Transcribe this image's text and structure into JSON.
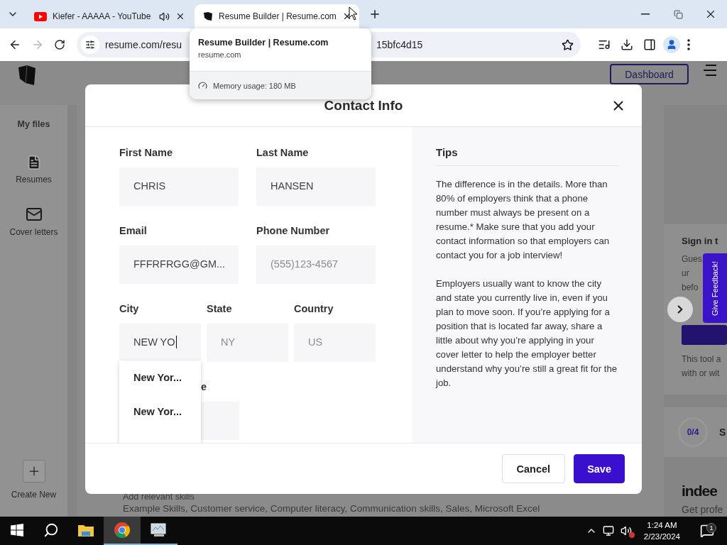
{
  "browser": {
    "tabs": [
      {
        "title": "Kiefer - AAAAA - YouTube",
        "kind": "video",
        "selected": false,
        "audio": true
      },
      {
        "title": "Resume Builder | Resume.com",
        "kind": "site",
        "selected": true,
        "audio": false
      }
    ],
    "forward_disabled": true,
    "address": {
      "url_start": "resume.com/resu",
      "url_end": "15bfc4d15"
    },
    "hover_card": {
      "title": "Resume Builder | Resume.com",
      "domain": "resume.com",
      "memory": "Memory usage: 180 MB"
    }
  },
  "page": {
    "header": {
      "dashboard": "Dashboard"
    },
    "sidebar": {
      "heading": "My files",
      "items": [
        {
          "label": "Resumes",
          "kind": "document"
        },
        {
          "label": "Cover letters",
          "kind": "mail"
        }
      ],
      "create": "Create New"
    },
    "content": {
      "hint": "Add relevant skills",
      "example": "Example Skills, Customer service, Computer literacy, Communication skills, Sales, Microsoft Excel"
    },
    "right_panel": {
      "heading": "Sign in t",
      "lines": [
        "Gues",
        "ur",
        "befo"
      ],
      "note": [
        "This tool a",
        "with or wit"
      ],
      "progress": "0/4",
      "progress_label": "S",
      "brand": "indee",
      "brand_text": "Get profe",
      "feedback": "Give Feedback!"
    }
  },
  "modal": {
    "title": "Contact Info",
    "rows": [
      [
        {
          "label": "First Name",
          "value": "CHRIS",
          "focused": false
        },
        {
          "label": "Last Name",
          "value": "HANSEN",
          "focused": false
        }
      ],
      [
        {
          "label": "Email",
          "value": "FFFRFRGG@GM...",
          "focused": false
        },
        {
          "label": "Phone Number",
          "placeholder": "(555)123-4567",
          "focused": false
        }
      ],
      [
        {
          "label": "City",
          "value": "NEW YO",
          "focused": true
        },
        {
          "label": "State",
          "placeholder": "NY",
          "focused": false
        },
        {
          "label": "Country",
          "placeholder": "US",
          "focused": false
        }
      ],
      [
        {
          "label": "e",
          "focused": false
        }
      ]
    ],
    "suggestions": [
      "New Yor...",
      "New Yor..."
    ],
    "tips": {
      "heading": "Tips",
      "paragraphs": [
        "The difference is in the details. More than 80% of employers think that a phone number must always be present on a resume.* Make sure that you add your contact information so that employers can contact you for a job interview!",
        "Employers usually want to know the city and state you currently live in, even if you plan to move soon. If you’re applying for a position that is located far away, share a little about why you’re applying in your cover letter to help the employer better understand why you’re still a great fit for the job."
      ]
    },
    "buttons": {
      "cancel": "Cancel",
      "save": "Save"
    }
  },
  "taskbar": {
    "apps": [
      {
        "kind": "files",
        "selected": false,
        "running": false
      },
      {
        "kind": "chrome",
        "selected": true,
        "running": true
      },
      {
        "kind": "monitor",
        "selected": false,
        "running": true
      }
    ],
    "volume_muted": true,
    "time": "1:24 AM",
    "date": "2/23/2024",
    "notifications": "1"
  }
}
